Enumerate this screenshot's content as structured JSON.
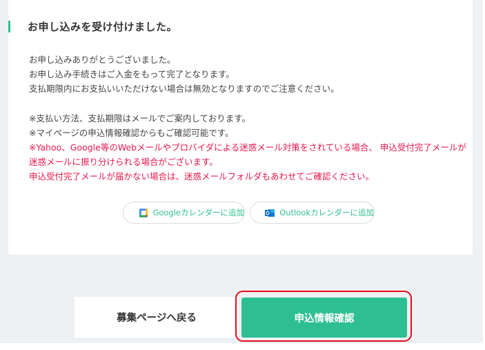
{
  "confirmation": {
    "heading": "お申し込みを受け付けました。",
    "intro_lines": [
      "お申し込みありがとうございました。",
      "お申し込み手続きはご入金をもって完了となります。",
      "支払期限内にお支払いいただけない場合は無効となりますのでご注意ください。"
    ],
    "note_lines": [
      "※支払い方法、支払期限はメールでご案内しております。",
      "※マイページの申込情報確認からもご確認可能です。"
    ],
    "warning_lines": [
      "※Yahoo、Google等のWebメールやプロバイダによる迷惑メール対策をされている場合、 申込受付完了メールが",
      "迷惑メールに振り分けられる場合がございます。",
      "申込受付完了メールが届かない場合は、迷惑メールフォルダもあわせてご確認ください。"
    ],
    "calendar": {
      "google_label": "Googleカレンダーに追加",
      "outlook_label": "Outlookカレンダーに追加"
    }
  },
  "actions": {
    "back_label": "募集ページへ戻る",
    "confirm_label": "申込情報確認"
  },
  "colors": {
    "accent": "#2ebf91",
    "warning_text": "#e6174d",
    "highlight_ring": "#e20c1c",
    "background": "#eef1f3"
  },
  "icons": [
    "google-calendar-icon",
    "outlook-calendar-icon"
  ]
}
